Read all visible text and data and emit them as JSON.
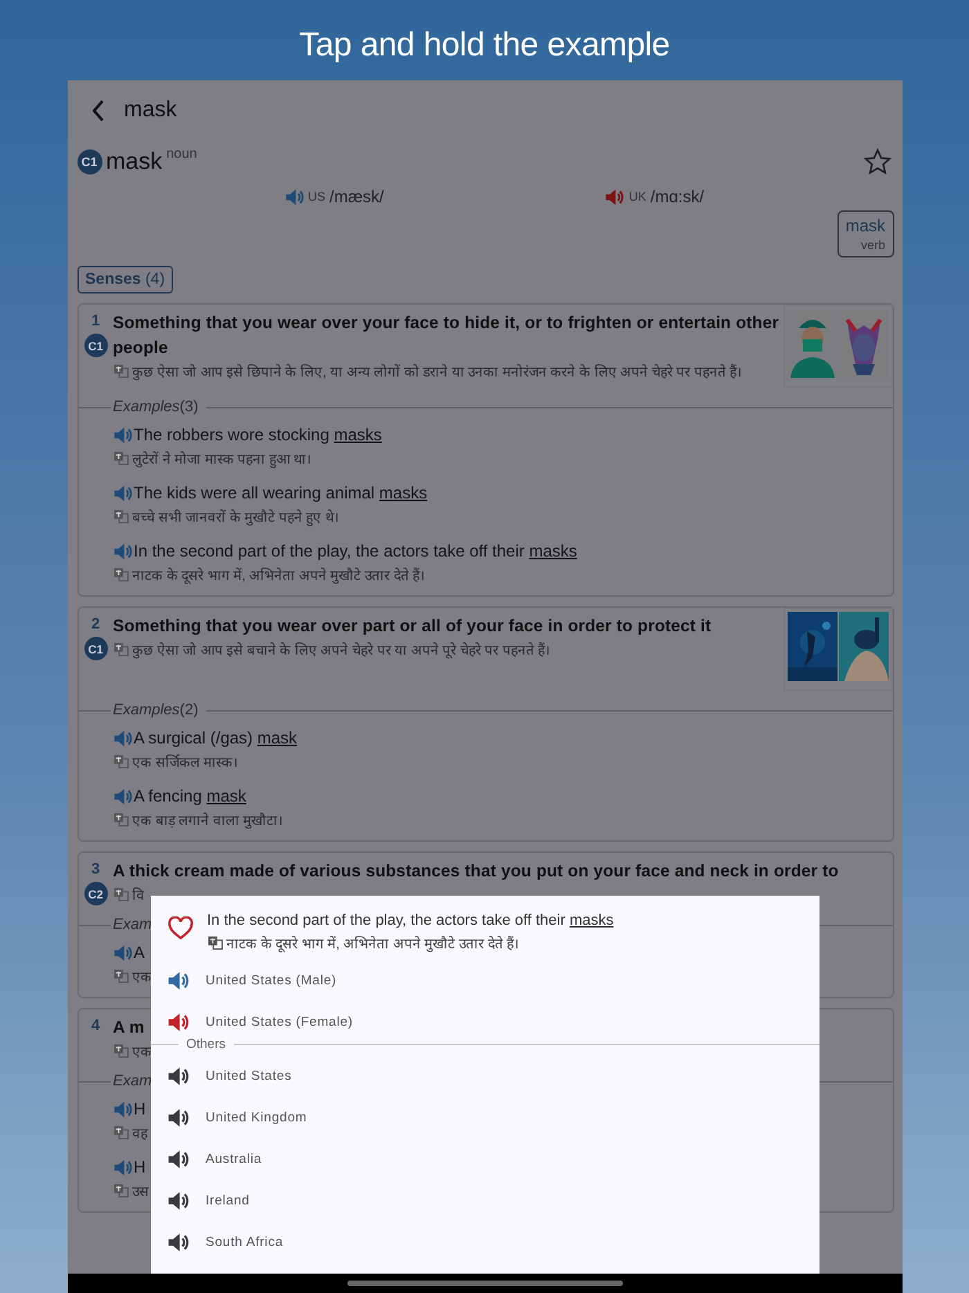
{
  "caption": "Tap and hold the example",
  "nav": {
    "title": "mask"
  },
  "entry": {
    "level": "C1",
    "headword": "mask",
    "pos": "noun",
    "bookmarked": false,
    "pronunciations": [
      {
        "region": "US",
        "ipa": "/mæsk/",
        "color": "#1f4a78"
      },
      {
        "region": "UK",
        "ipa": "/mɑ:sk/",
        "color": "#7a1414"
      }
    ],
    "related": {
      "word": "mask",
      "pos": "verb"
    }
  },
  "senses_button": {
    "label": "Senses",
    "count": "(4)"
  },
  "senses": [
    {
      "number": "1",
      "level": "C1",
      "definition": "Something that you wear over your face to hide it, or to frighten or entertain other people",
      "translation": "कुछ ऐसा जो आप इसे छिपाने के लिए, या अन्य लोगों को डराने या उनका मनोरंजन करने के लिए अपने चेहरे पर पहनते हैं।",
      "pictures": [
        {
          "kind": "picture"
        },
        {
          "kind": "picture"
        }
      ],
      "examples_label": "Examples",
      "examples_count": "(3)",
      "examples": [
        {
          "text": "The robbers wore stocking",
          "keyword": "masks",
          "translation": "लुटेरों ने मोजा मास्क पहना हुआ था।"
        },
        {
          "text": "The kids were all wearing animal",
          "keyword": "masks",
          "translation": "बच्चे सभी जानवरों के मुखौटे पहने हुए थे।"
        },
        {
          "text": "In the second part of the play, the actors take off their",
          "keyword": "masks",
          "translation": "नाटक के दूसरे भाग में, अभिनेता अपने मुखौटे उतार देते हैं।"
        }
      ]
    },
    {
      "number": "2",
      "level": "C1",
      "definition": "Something that you wear over part or all of your face in order to protect it",
      "translation": "कुछ ऐसा जो आप इसे बचाने के लिए अपने चेहरे पर या अपने पूरे चेहरे पर पहनते हैं।",
      "pictures": [
        {
          "kind": "picture"
        },
        {
          "kind": "picture"
        }
      ],
      "examples_label": "Examples",
      "examples_count": "(2)",
      "examples": [
        {
          "text": "A surgical (/gas)",
          "keyword": "mask",
          "translation": "एक सर्जिकल मास्क।"
        },
        {
          "text": "A fencing",
          "keyword": "mask",
          "translation": "एक बाड़ लगाने वाला मुखौटा।"
        }
      ]
    },
    {
      "number": "3",
      "level": "C2",
      "definition": "A thick cream made of various substances that you put on your face and neck in order to",
      "translation": "वि",
      "examples_label": "Exam",
      "examples": [
        {
          "text": "A",
          "translation": "एक"
        }
      ]
    },
    {
      "number": "4",
      "definition": "A m",
      "translation": "एक",
      "examples_label": "Exam",
      "examples": [
        {
          "text": "H",
          "translation": "वह"
        },
        {
          "text": "H",
          "translation": "उस"
        }
      ]
    }
  ],
  "popup": {
    "favorite": false,
    "sentence": "In the second part of the play, the actors take off their",
    "keyword": "masks",
    "translation": "नाटक के दूसरे भाग में, अभिनेता अपने मुखौटे उतार देते हैं।",
    "voices": [
      {
        "label": "United States (Male)",
        "color": "#2f6aa3"
      },
      {
        "label": "United States (Female)",
        "color": "#c0232a"
      }
    ],
    "others_label": "Others",
    "others": [
      {
        "label": "United States"
      },
      {
        "label": "United Kingdom"
      },
      {
        "label": "Australia"
      },
      {
        "label": "Ireland"
      },
      {
        "label": "South Africa"
      }
    ]
  }
}
